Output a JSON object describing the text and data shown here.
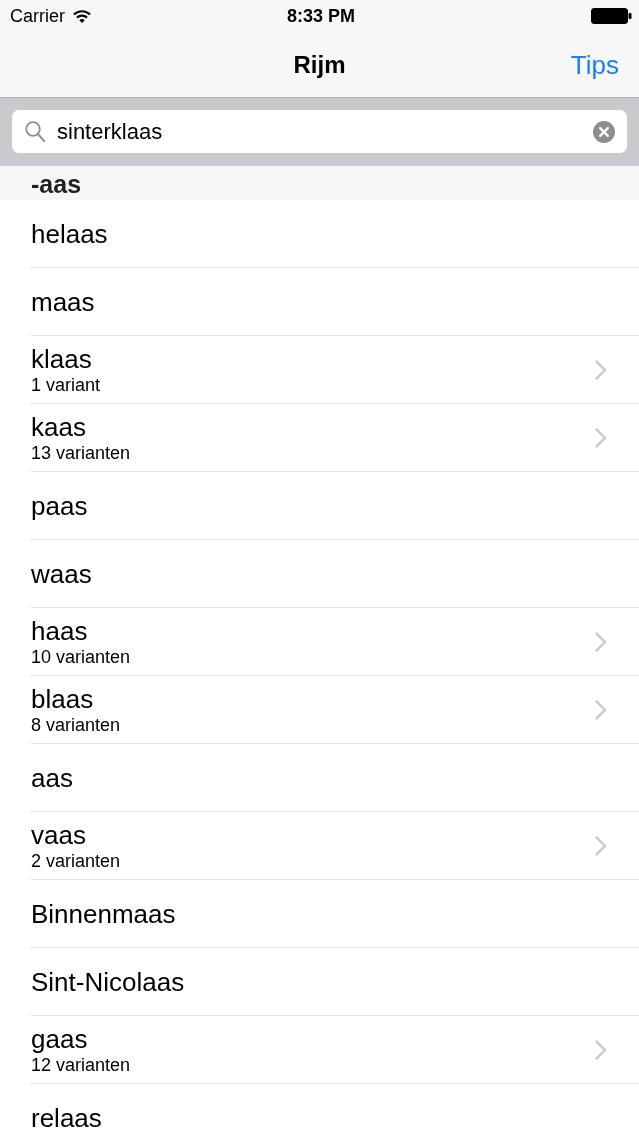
{
  "status_bar": {
    "carrier": "Carrier",
    "time": "8:33 PM"
  },
  "nav_bar": {
    "title": "Rijm",
    "right_button": "Tips"
  },
  "search": {
    "value": "sinterklaas"
  },
  "section": {
    "header": "-aas",
    "rows": [
      {
        "word": "helaas",
        "disclosure": false
      },
      {
        "word": "maas",
        "disclosure": false
      },
      {
        "word": "klaas",
        "variants": "1 variant",
        "disclosure": true
      },
      {
        "word": "kaas",
        "variants": "13 varianten",
        "disclosure": true
      },
      {
        "word": "paas",
        "disclosure": false
      },
      {
        "word": "waas",
        "disclosure": false
      },
      {
        "word": "haas",
        "variants": "10 varianten",
        "disclosure": true
      },
      {
        "word": "blaas",
        "variants": "8 varianten",
        "disclosure": true
      },
      {
        "word": "aas",
        "disclosure": false
      },
      {
        "word": "vaas",
        "variants": "2 varianten",
        "disclosure": true
      },
      {
        "word": "Binnenmaas",
        "disclosure": false
      },
      {
        "word": "Sint-Nicolaas",
        "disclosure": false
      },
      {
        "word": "gaas",
        "variants": "12 varianten",
        "disclosure": true
      },
      {
        "word": "relaas",
        "disclosure": false
      }
    ]
  }
}
